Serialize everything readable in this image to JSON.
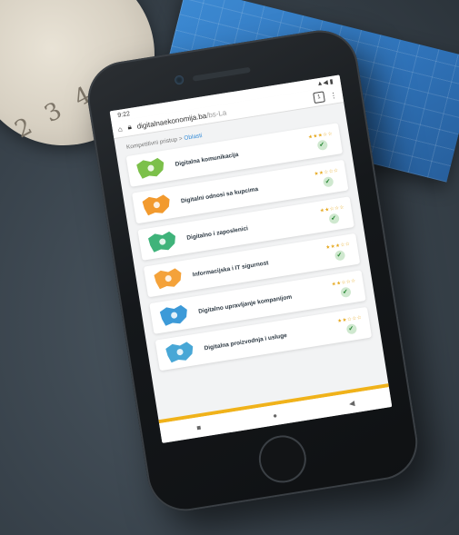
{
  "background": {
    "tape_numbers": "2 3 4 5"
  },
  "status_bar": {
    "time": "9:22",
    "right": "▲◀ ▮"
  },
  "browser": {
    "url": "digitalnaekonomija.ba",
    "url_path": "/bs-La",
    "tab_count": "1",
    "menu": "⋮"
  },
  "breadcrumb": {
    "home": "Kompetitivni pristup",
    "separator": ">",
    "current": "Oblasti"
  },
  "cards": [
    {
      "label": "Digitalna komunikacija",
      "stars": "★★★☆☆",
      "color": "#7cc04a"
    },
    {
      "label": "Digitalni odnosi sa kupcima",
      "stars": "★★☆☆☆",
      "color": "#f29a2e"
    },
    {
      "label": "Digitalno i zaposlenici",
      "stars": "★★☆☆☆",
      "color": "#3fb37a"
    },
    {
      "label": "Informacijska i IT sigurnost",
      "stars": "★★★☆☆",
      "color": "#f4a23a"
    },
    {
      "label": "Digitalno upravljanje kompanijom",
      "stars": "★★☆☆☆",
      "color": "#3c9ad8"
    },
    {
      "label": "Digitalna proizvodnja i usluge",
      "stars": "★★☆☆☆",
      "color": "#48a7d6"
    }
  ],
  "nav": {
    "recents": "■",
    "home": "●",
    "back": "◀"
  }
}
